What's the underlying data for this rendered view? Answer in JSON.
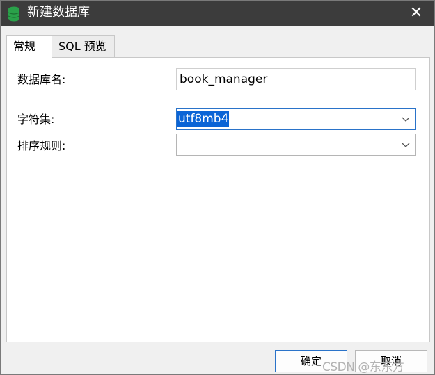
{
  "window": {
    "title": "新建数据库",
    "close_glyph": "✕",
    "icon": "database-icon",
    "titlebar_color": "#3c3c3c",
    "icon_color": "#2aa14a"
  },
  "tabs": [
    {
      "label": "常规",
      "active": true
    },
    {
      "label": "SQL 预览",
      "active": false
    }
  ],
  "form": {
    "db_name_label": "数据库名:",
    "db_name_value": "book_manager",
    "charset_label": "字符集:",
    "charset_value": "utf8mb4",
    "collation_label": "排序规则:",
    "collation_value": ""
  },
  "buttons": {
    "ok": "确定",
    "cancel": "取消"
  },
  "watermark": {
    "text": "CSDN @东东方",
    "small": "CSDN @东东方"
  },
  "colors": {
    "focus_border": "#2a73c9",
    "selection": "#0a64d6"
  }
}
